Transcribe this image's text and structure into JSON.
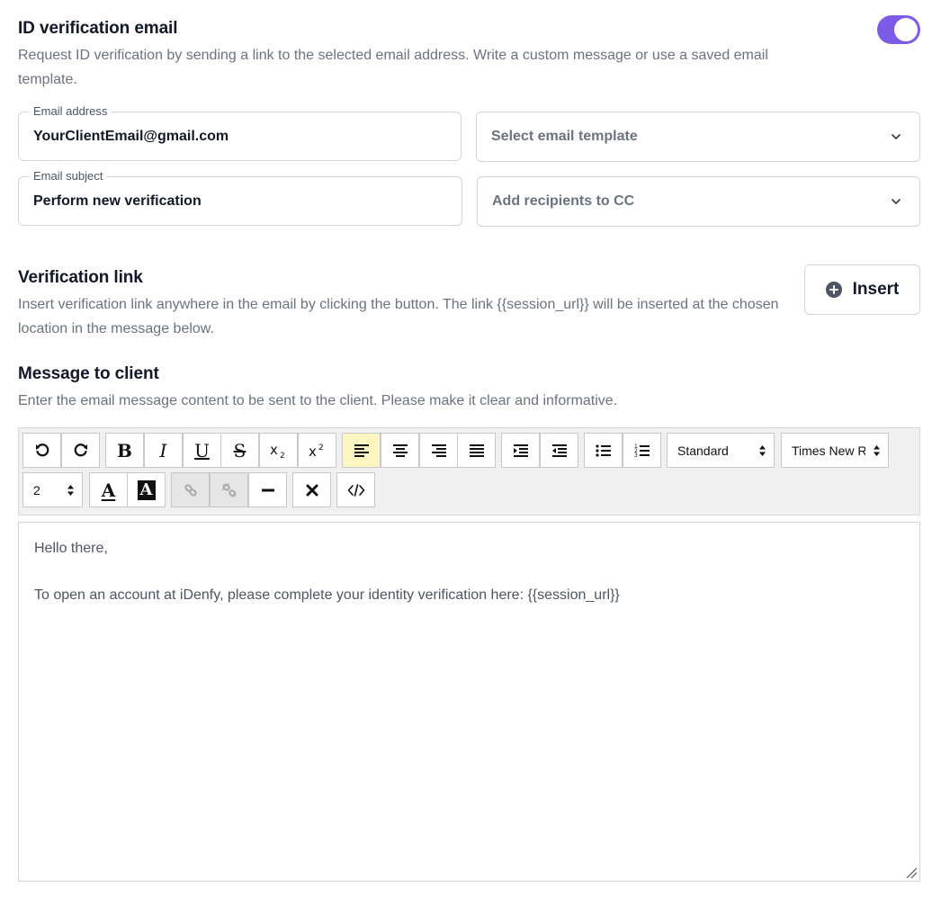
{
  "id_email": {
    "title": "ID verification email",
    "description": "Request ID verification by sending a link to the selected email address. Write a custom message or use a saved email template.",
    "toggle_on": true
  },
  "email_address": {
    "label": "Email address",
    "value": "YourClientEmail@gmail.com"
  },
  "email_template": {
    "placeholder": "Select email template"
  },
  "email_subject": {
    "label": "Email subject",
    "value": "Perform new verification"
  },
  "cc": {
    "placeholder": "Add recipients to CC"
  },
  "verification_link": {
    "title": "Verification link",
    "description": "Insert verification link anywhere in the email by clicking the button. The link {{session_url}} will be inserted at the chosen location in the message below.",
    "insert_label": "Insert"
  },
  "message": {
    "title": "Message to client",
    "description": "Enter the email message content to be sent to the client. Please make it clear and informative.",
    "lines": [
      "Hello there,",
      "",
      "To open an account at iDenfy, please complete your identity verification here: {{session_url}}"
    ]
  },
  "toolbar": {
    "format_select": "Standard",
    "font_select": "Times New Roman",
    "size_select": "2",
    "buttons": {
      "bold": "B",
      "italic": "I",
      "underline": "U",
      "strike": "S",
      "text_color": "A",
      "bg_color": "A"
    },
    "active": "align-left"
  },
  "colors": {
    "accent": "#7c5ce6",
    "text": "#111827",
    "muted": "#6b7280",
    "border": "#d1d5db",
    "active_button": "#fdf6c3"
  }
}
